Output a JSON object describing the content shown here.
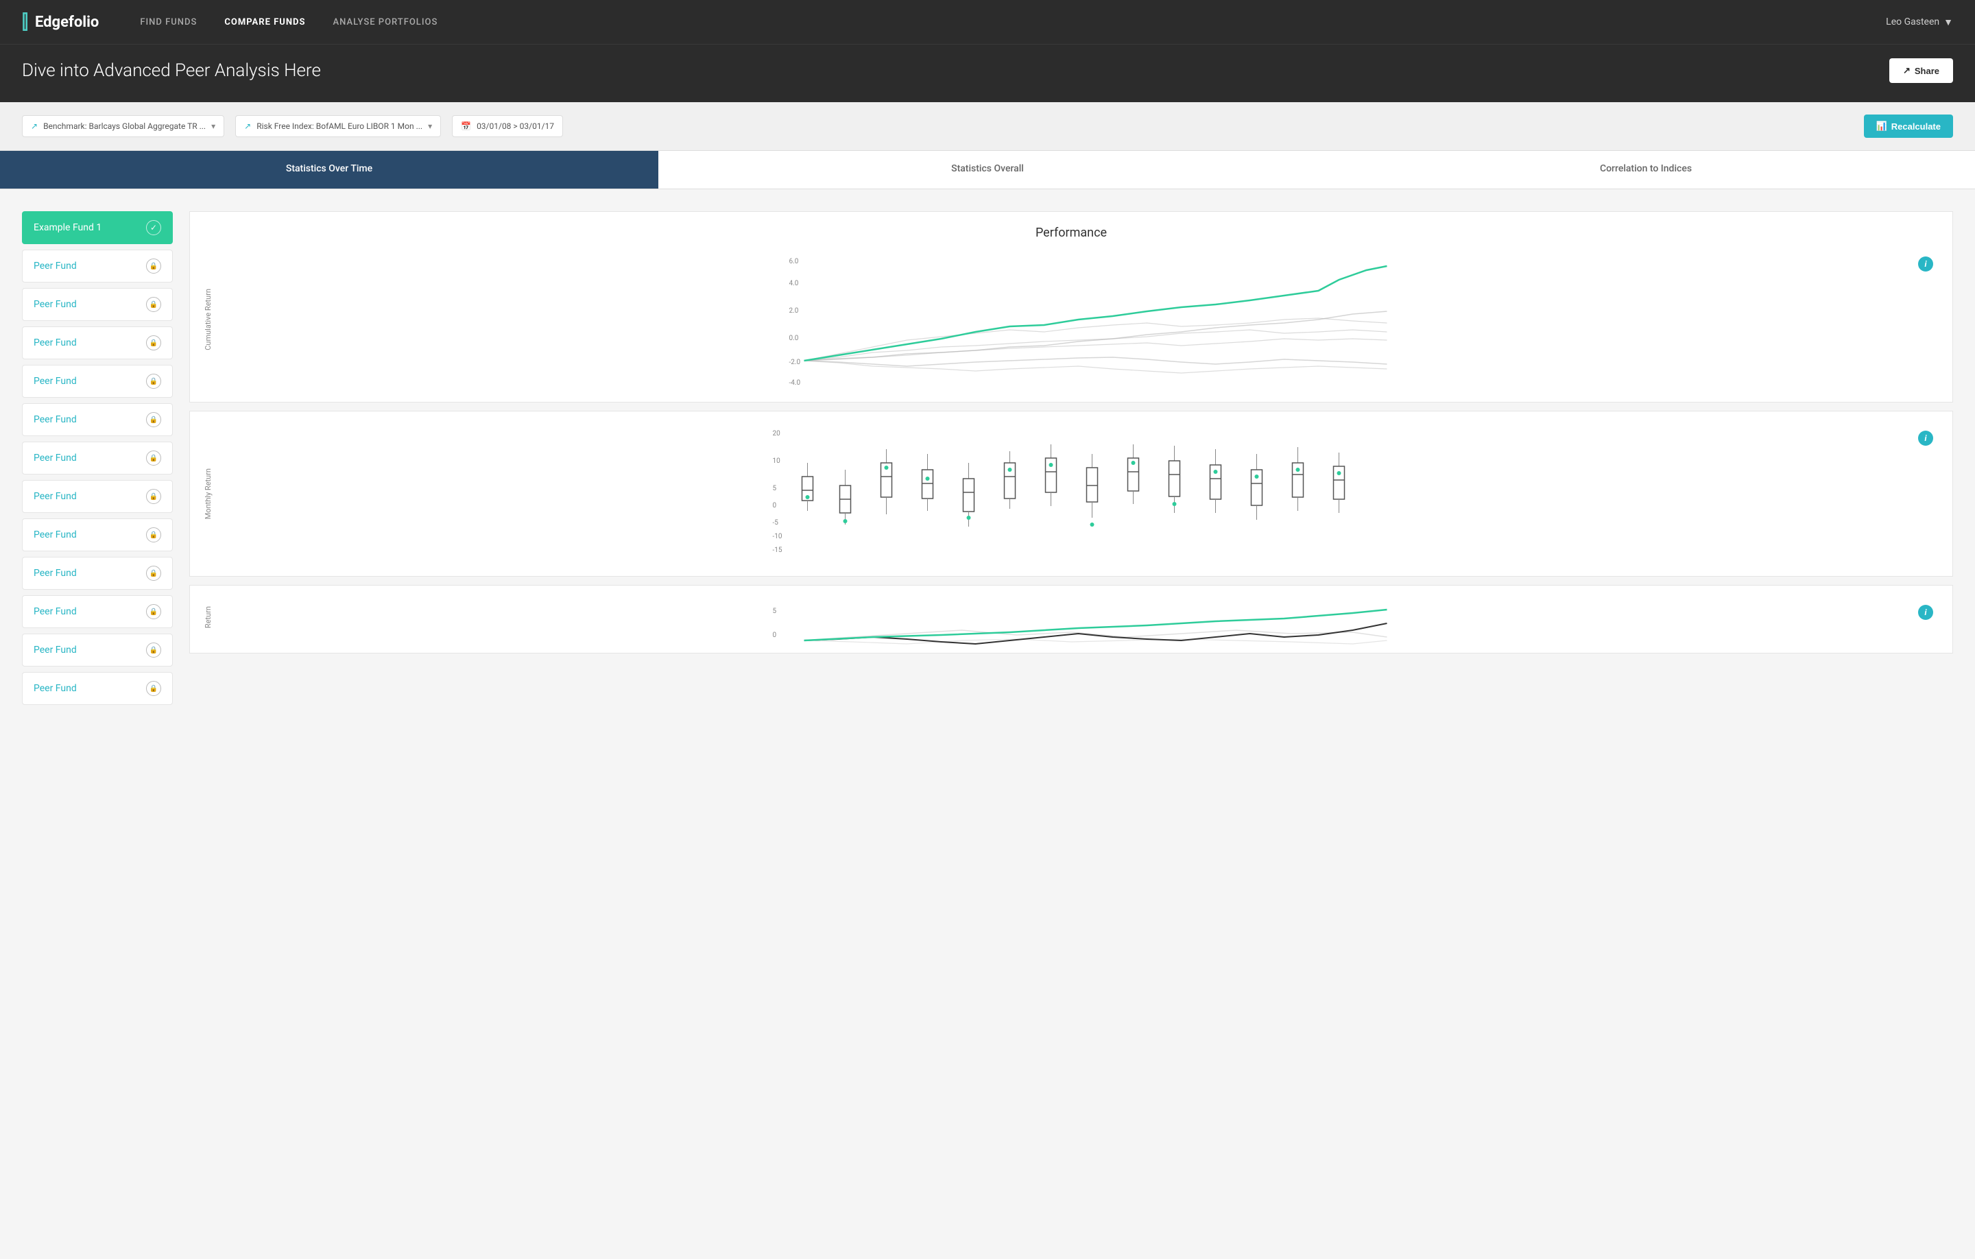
{
  "nav": {
    "logo": "Edgefolio",
    "logo_icon": "|||",
    "links": [
      {
        "label": "FIND FUNDS",
        "active": false
      },
      {
        "label": "COMPARE FUNDS",
        "active": true
      },
      {
        "label": "ANALYSE PORTFOLIOS",
        "active": false
      }
    ],
    "user": "Leo Gasteen",
    "user_caret": "▼"
  },
  "header": {
    "title": "Dive into Advanced Peer Analysis Here",
    "share_label": "Share"
  },
  "filters": {
    "benchmark_label": "Benchmark: Barlcays Global Aggregate TR ...",
    "risk_free_label": "Risk Free Index: BofAML Euro LIBOR 1 Mon ...",
    "date_range": "03/01/08 > 03/01/17",
    "recalculate_label": "Recalculate"
  },
  "tabs": [
    {
      "label": "Statistics Over Time",
      "active": true
    },
    {
      "label": "Statistics Overall",
      "active": false
    },
    {
      "label": "Correlation to Indices",
      "active": false
    }
  ],
  "fund_list": {
    "active_fund": "Example Fund 1",
    "peer_funds": [
      "Peer Fund",
      "Peer Fund",
      "Peer Fund",
      "Peer Fund",
      "Peer Fund",
      "Peer Fund",
      "Peer Fund",
      "Peer Fund",
      "Peer Fund",
      "Peer Fund",
      "Peer Fund",
      "Peer Fund"
    ]
  },
  "charts": {
    "performance_title": "Performance",
    "performance_y_label": "Cumulative Return",
    "monthly_return_y_label": "Monthly Return",
    "info_icon": "i"
  }
}
